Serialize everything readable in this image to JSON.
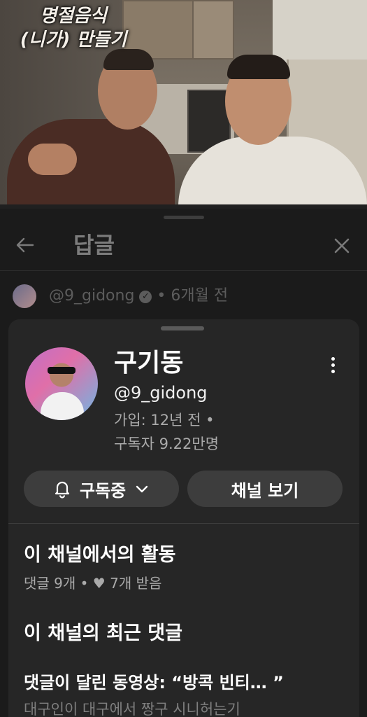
{
  "video": {
    "overlay_line1": "명절음식",
    "overlay_line2": "(니가) 만들기"
  },
  "replies_header": {
    "back_icon": "arrow-left-icon",
    "title": "답글",
    "close_icon": "close-icon"
  },
  "comment": {
    "author": "@9_gidong",
    "verified_icon": "verified-check-icon",
    "time": "6개월 전"
  },
  "channel": {
    "name": "구기동",
    "handle": "@9_gidong",
    "joined": "가입: 12년 전 •",
    "subscribers": "구독자 9.22만명",
    "more_icon": "more-vertical-icon",
    "subscribe_button": "구독중",
    "subscribe_icon": "bell-icon",
    "dropdown_icon": "chevron-down-icon",
    "view_channel_button": "채널 보기"
  },
  "activity": {
    "title": "이 채널에서의 활동",
    "comments": "댓글 9개 •",
    "likes": "7개 받음",
    "heart_icon": "heart-icon"
  },
  "recent_comments": {
    "title": "이 채널의 최근 댓글",
    "video_title": "댓글이 달린 동영상: “방콕 빈티… ”",
    "snippet": "대구인이 대구에서 짱구 시니허는기"
  }
}
